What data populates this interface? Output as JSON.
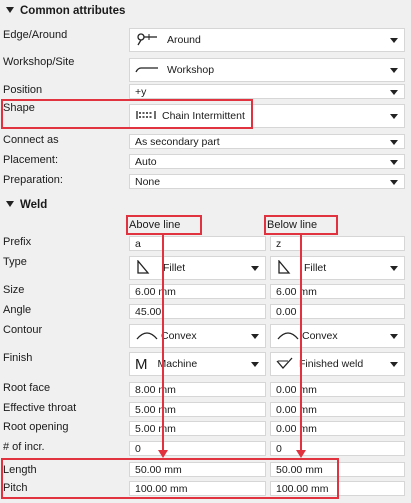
{
  "common": {
    "title": "Common attributes",
    "rows": [
      {
        "label": "Edge/Around",
        "value": "Around",
        "icon": "around-flag-icon"
      },
      {
        "label": "Workshop/Site",
        "value": "Workshop",
        "icon": "workshop-line-icon"
      },
      {
        "label": "Position",
        "value": "+y"
      },
      {
        "label": "Shape",
        "value": "Chain Intermittent",
        "icon": "chain-intermittent-icon"
      },
      {
        "label": "Connect as",
        "value": "As secondary part"
      },
      {
        "label": "Placement:",
        "value": "Auto"
      },
      {
        "label": "Preparation:",
        "value": "None"
      }
    ]
  },
  "weld": {
    "title": "Weld",
    "above_label": "Above line",
    "below_label": "Below line",
    "rows": {
      "prefix": {
        "label": "Prefix",
        "above": "a",
        "below": "z"
      },
      "type": {
        "label": "Type",
        "above": "Fillet",
        "below": "Fillet"
      },
      "size": {
        "label": "Size",
        "above": "6.00 mm",
        "below": "6.00 mm"
      },
      "angle": {
        "label": "Angle",
        "above": "45.00",
        "below": "0.00"
      },
      "contour": {
        "label": "Contour",
        "above": "Convex",
        "below": "Convex"
      },
      "finish": {
        "label": "Finish",
        "above": "Machine",
        "below": "Finished weld"
      },
      "root_face": {
        "label": "Root face",
        "above": "8.00 mm",
        "below": "0.00 mm"
      },
      "effective_throat": {
        "label": "Effective throat",
        "above": "5.00 mm",
        "below": "0.00 mm"
      },
      "root_opening": {
        "label": "Root opening",
        "above": "5.00 mm",
        "below": "0.00 mm"
      },
      "num_incr": {
        "label": "# of incr.",
        "above": "0",
        "below": "0"
      },
      "length": {
        "label": "Length",
        "above": "50.00 mm",
        "below": "50.00 mm"
      },
      "pitch": {
        "label": "Pitch",
        "above": "100.00 mm",
        "below": "100.00 mm"
      }
    },
    "finish_above_glyph": "M"
  },
  "colors": {
    "highlight": "#e0323f",
    "background": "#f0f0f0",
    "field": "#ffffff"
  }
}
